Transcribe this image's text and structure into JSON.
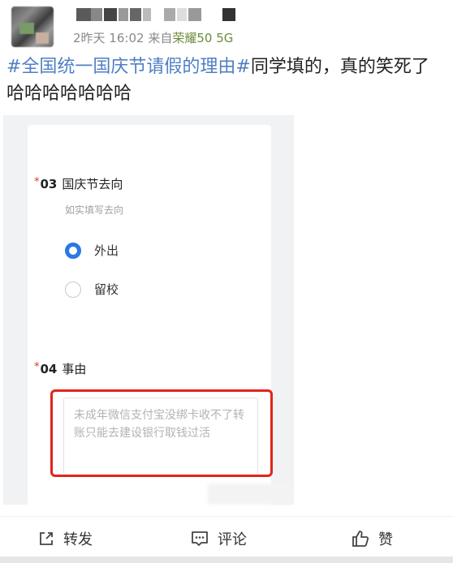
{
  "post": {
    "meta_time": "2昨天 16:02",
    "meta_from": "来自",
    "meta_device": "荣耀50 5G",
    "topic": "#全国统一国庆节请假的理由#",
    "text": "同学填的，真的笑死了哈哈哈哈哈哈哈"
  },
  "form": {
    "q3": {
      "star": "*",
      "num": "03",
      "title": "国庆节去向",
      "hint": "如实填写去向"
    },
    "options": [
      {
        "label": "外出",
        "selected": true
      },
      {
        "label": "留校",
        "selected": false
      }
    ],
    "q4": {
      "star": "*",
      "num": "04",
      "title": "事由"
    },
    "answer": "未成年微信支付宝没绑卡收不了转账只能去建设银行取钱过活",
    "accent_color": "#2a78e4",
    "highlight_color": "#e3231b"
  },
  "actions": {
    "repost": "转发",
    "comment": "评论",
    "like": "赞"
  },
  "icons": [
    "share-icon",
    "comment-icon",
    "thumb-up-icon",
    "radio-icon"
  ]
}
